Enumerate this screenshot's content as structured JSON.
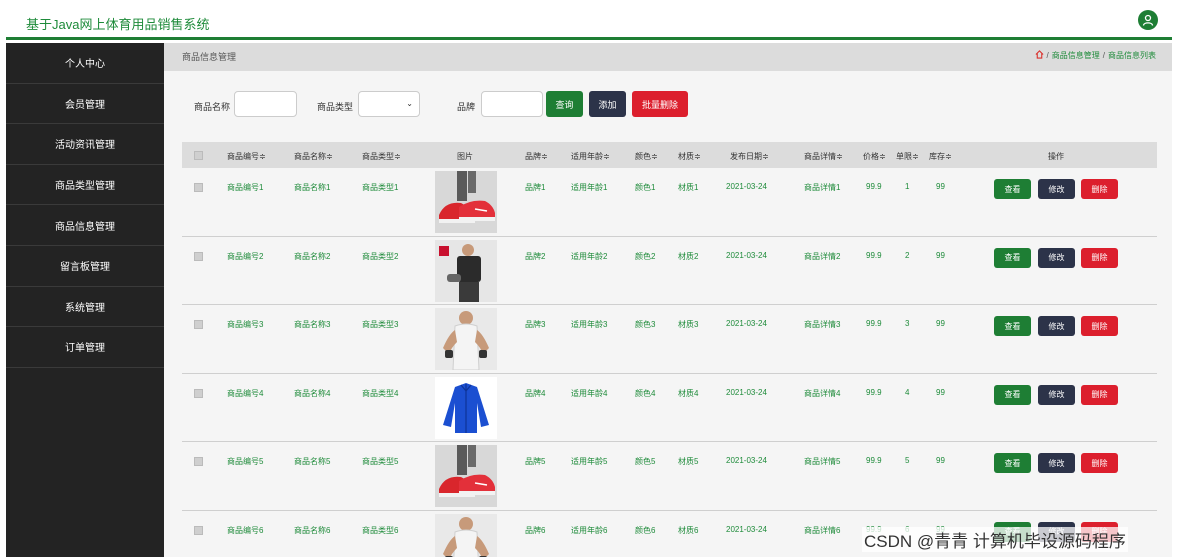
{
  "header": {
    "title": "基于Java网上体育用品销售系统",
    "user_icon": "user-icon"
  },
  "sidebar": {
    "items": [
      {
        "label": "个人中心"
      },
      {
        "label": "会员管理"
      },
      {
        "label": "活动资讯管理"
      },
      {
        "label": "商品类型管理"
      },
      {
        "label": "商品信息管理"
      },
      {
        "label": "留言板管理"
      },
      {
        "label": "系统管理"
      },
      {
        "label": "订单管理"
      }
    ]
  },
  "page": {
    "title": "商品信息管理",
    "breadcrumb": {
      "sep": "/",
      "level1": "商品信息管理",
      "level2": "商品信息列表"
    }
  },
  "search": {
    "name_label": "商品名称",
    "type_label": "商品类型",
    "brand_label": "品牌",
    "query_button": "查询",
    "add_button": "添加",
    "batch_delete_button": "批量删除"
  },
  "table": {
    "headers": [
      "商品编号≑",
      "商品名称≑",
      "商品类型≑",
      "图片",
      "品牌≑",
      "适用年龄≑",
      "颜色≑",
      "材质≑",
      "发布日期≑",
      "商品详情≑",
      "价格≑",
      "单限≑",
      "库存≑",
      "操作"
    ],
    "actions": {
      "view": "查看",
      "edit": "修改",
      "delete": "删除"
    },
    "rows": [
      {
        "code": "商品编号1",
        "name": "商品名称1",
        "type": "商品类型1",
        "picture": "red-shoes",
        "brand": "品牌1",
        "age": "适用年龄1",
        "color": "颜色1",
        "material": "材质1",
        "date": "2021-03-24",
        "detail": "商品详情1",
        "price": "99.9",
        "limit": "1",
        "stock": "99"
      },
      {
        "code": "商品编号2",
        "name": "商品名称2",
        "type": "商品类型2",
        "picture": "fitness-man",
        "brand": "品牌2",
        "age": "适用年龄2",
        "color": "颜色2",
        "material": "材质2",
        "date": "2021-03-24",
        "detail": "商品详情2",
        "price": "99.9",
        "limit": "2",
        "stock": "99"
      },
      {
        "code": "商品编号3",
        "name": "商品名称3",
        "type": "商品类型3",
        "picture": "tank-top-man",
        "brand": "品牌3",
        "age": "适用年龄3",
        "color": "颜色3",
        "material": "材质3",
        "date": "2021-03-24",
        "detail": "商品详情3",
        "price": "99.9",
        "limit": "3",
        "stock": "99"
      },
      {
        "code": "商品编号4",
        "name": "商品名称4",
        "type": "商品类型4",
        "picture": "blue-jacket",
        "brand": "品牌4",
        "age": "适用年龄4",
        "color": "颜色4",
        "material": "材质4",
        "date": "2021-03-24",
        "detail": "商品详情4",
        "price": "99.9",
        "limit": "4",
        "stock": "99"
      },
      {
        "code": "商品编号5",
        "name": "商品名称5",
        "type": "商品类型5",
        "picture": "red-shoes",
        "brand": "品牌5",
        "age": "适用年龄5",
        "color": "颜色5",
        "material": "材质5",
        "date": "2021-03-24",
        "detail": "商品详情5",
        "price": "99.9",
        "limit": "5",
        "stock": "99"
      },
      {
        "code": "商品编号6",
        "name": "商品名称6",
        "type": "商品类型6",
        "picture": "tank-top-man",
        "brand": "品牌6",
        "age": "适用年龄6",
        "color": "颜色6",
        "material": "材质6",
        "date": "2021-03-24",
        "detail": "商品详情6",
        "price": "99.9",
        "limit": "6",
        "stock": "99"
      }
    ]
  },
  "watermark": "CSDN @青青  计算机毕设源码程序",
  "colors": {
    "primary_green": "#1e7e34",
    "sidebar": "#232323",
    "dark_button": "#2c3349",
    "danger": "#dc1f2d"
  }
}
